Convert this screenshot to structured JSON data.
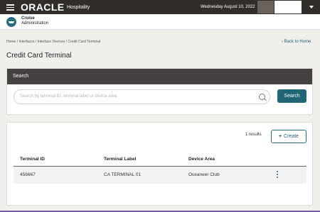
{
  "topbar": {
    "brand": "ORACLE",
    "brand_sub": "Hospitality",
    "date": "Wednesday August 10, 2022"
  },
  "app": {
    "name": "Cruise",
    "subtitle": "Administration"
  },
  "breadcrumb": "Home / Interfaces / Interface Devices / Credit Card Terminal",
  "back_link": "Back to Home",
  "page_title": "Credit Card Terminal",
  "search": {
    "header": "Search",
    "placeholder": "Search by terminal ID, terminal label or device area",
    "button": "Search"
  },
  "results": {
    "count": "1 results",
    "create_label": "Create",
    "columns": [
      "Terminal ID",
      "Terminal Label",
      "Device Area"
    ],
    "rows": [
      {
        "terminal_id": "456667",
        "terminal_label": "CA TERMINAL 01",
        "device_area": "Oceaneer Club"
      }
    ]
  },
  "colors": {
    "topbar": "#312d2a",
    "accent": "#216676",
    "section_header": "#454140"
  }
}
